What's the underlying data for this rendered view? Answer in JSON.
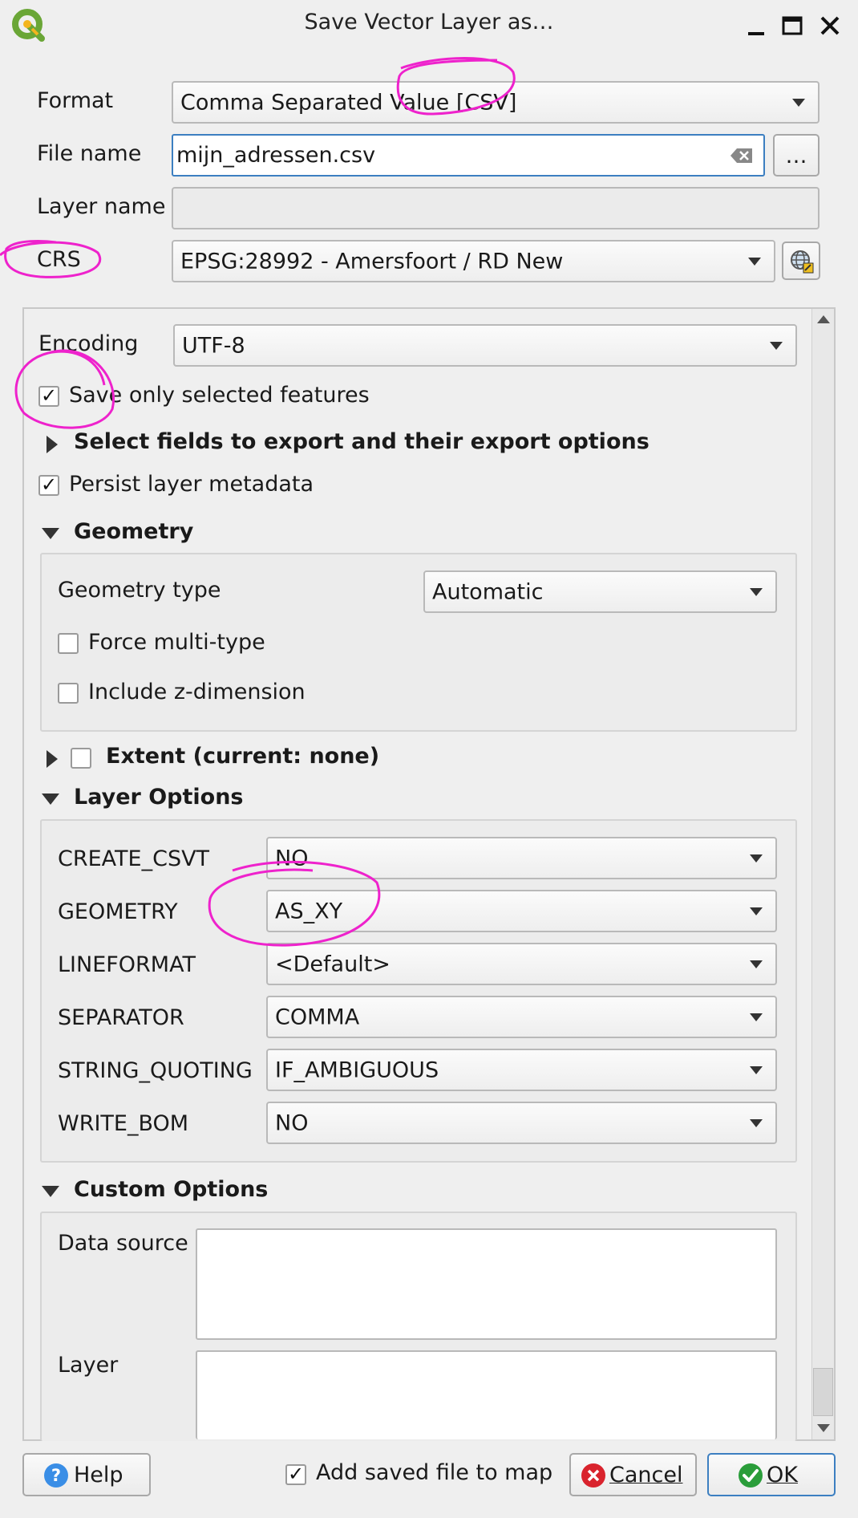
{
  "window": {
    "title": "Save Vector Layer as…"
  },
  "top_form": {
    "format_label": "Format",
    "format_value": "Comma Separated Value [CSV]",
    "filename_label": "File name",
    "filename_value": "mijn_adressen.csv",
    "browse_label": "…",
    "layername_label": "Layer name",
    "layername_value": "",
    "crs_label": "CRS",
    "crs_value": "EPSG:28992 - Amersfoort / RD New"
  },
  "panel": {
    "encoding_label": "Encoding",
    "encoding_value": "UTF-8",
    "save_selected_label": "Save only selected features",
    "save_selected_checked": true,
    "select_fields_label": "Select fields to export and their export options",
    "persist_metadata_label": "Persist layer metadata",
    "persist_metadata_checked": true,
    "geometry": {
      "header": "Geometry",
      "type_label": "Geometry type",
      "type_value": "Automatic",
      "force_multi_label": "Force multi-type",
      "force_multi_checked": false,
      "include_z_label": "Include z-dimension",
      "include_z_checked": false
    },
    "extent_label": "Extent (current: none)",
    "layer_options": {
      "header": "Layer Options",
      "rows": [
        {
          "label": "CREATE_CSVT",
          "value": "NO"
        },
        {
          "label": "GEOMETRY",
          "value": "AS_XY"
        },
        {
          "label": "LINEFORMAT",
          "value": "<Default>"
        },
        {
          "label": "SEPARATOR",
          "value": "COMMA"
        },
        {
          "label": "STRING_QUOTING",
          "value": "IF_AMBIGUOUS"
        },
        {
          "label": "WRITE_BOM",
          "value": "NO"
        }
      ]
    },
    "custom_options": {
      "header": "Custom Options",
      "datasource_label": "Data source",
      "layer_label": "Layer"
    }
  },
  "footer": {
    "help_label": "Help",
    "add_to_map_label": "Add saved file to map",
    "add_to_map_checked": true,
    "cancel_label": "Cancel",
    "ok_label": "OK"
  },
  "colors": {
    "annotation": "#ee22cc",
    "focus_border": "#3c7fc1",
    "cancel_red": "#d9232d",
    "ok_green": "#2a9d3a",
    "help_blue": "#3a8ee6",
    "qgis_green": "#6aa636",
    "qgis_yellow": "#f3b51e"
  },
  "icons": [
    "qgis-logo-icon",
    "minimize-icon",
    "maximize-icon",
    "close-icon",
    "clear-text-icon",
    "crs-globe-icon",
    "help-icon",
    "cancel-icon",
    "ok-icon"
  ]
}
